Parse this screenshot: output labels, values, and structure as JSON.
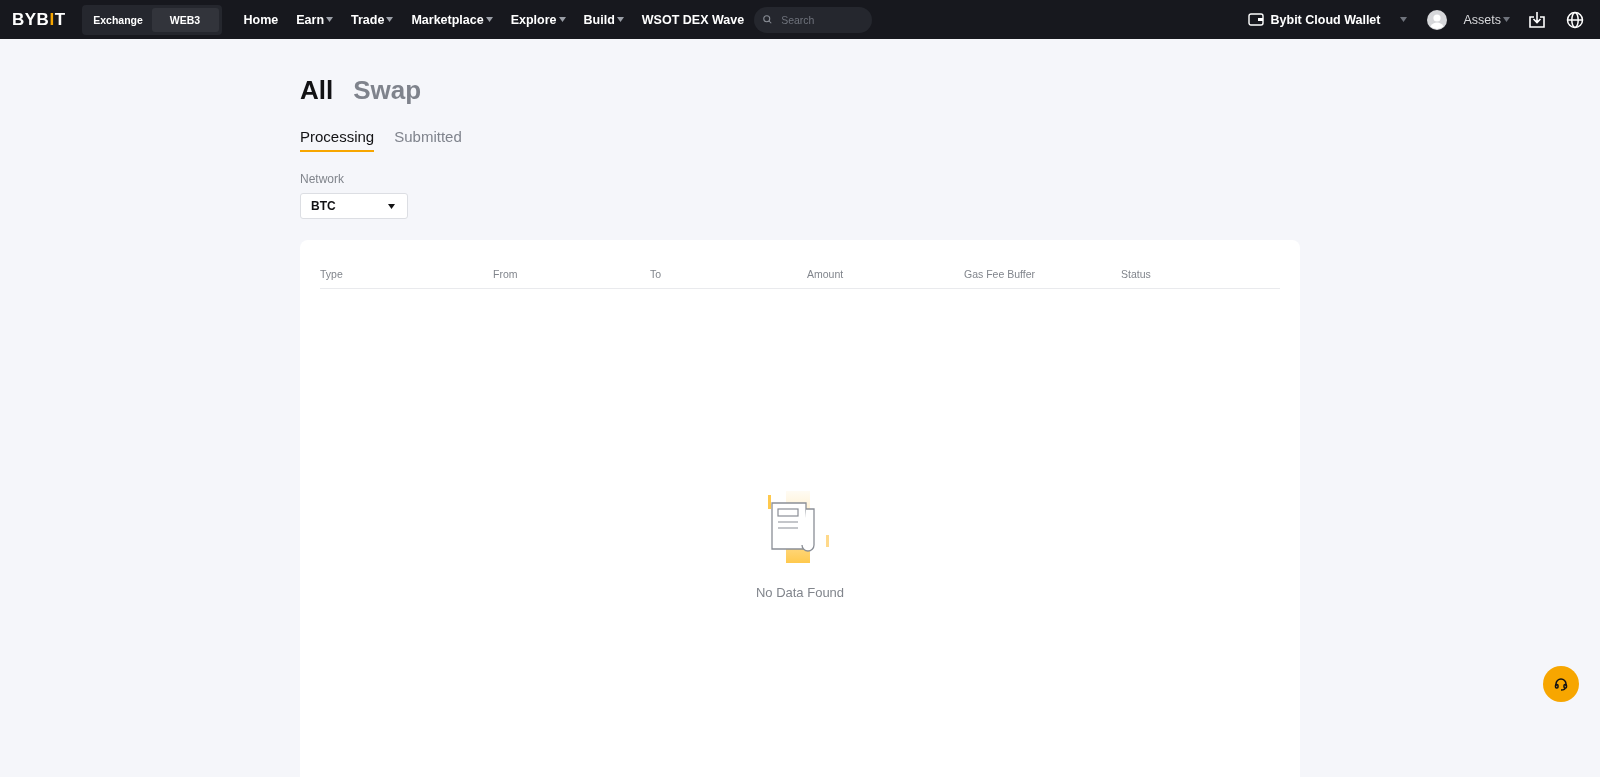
{
  "header": {
    "logo": "BYBIT",
    "mode_switch": [
      {
        "label": "Exchange",
        "selected": false
      },
      {
        "label": "WEB3",
        "selected": true
      }
    ],
    "nav": [
      {
        "label": "Home",
        "dropdown": false
      },
      {
        "label": "Earn",
        "dropdown": true
      },
      {
        "label": "Trade",
        "dropdown": true
      },
      {
        "label": "Marketplace",
        "dropdown": true
      },
      {
        "label": "Explore",
        "dropdown": true
      },
      {
        "label": "Build",
        "dropdown": true
      },
      {
        "label": "WSOT DEX Wave",
        "dropdown": false
      }
    ],
    "search": {
      "placeholder": "Search"
    },
    "wallet": "Bybit Cloud Wallet",
    "assets": "Assets"
  },
  "page_tabs": [
    {
      "label": "All",
      "selected": true
    },
    {
      "label": "Swap",
      "selected": false
    }
  ],
  "sub_tabs": [
    {
      "label": "Processing",
      "selected": true
    },
    {
      "label": "Submitted",
      "selected": false
    }
  ],
  "network": {
    "label": "Network",
    "value": "BTC"
  },
  "table": {
    "columns": [
      "Type",
      "From",
      "To",
      "Amount",
      "Gas Fee Buffer",
      "Status"
    ],
    "empty_text": "No Data Found"
  }
}
